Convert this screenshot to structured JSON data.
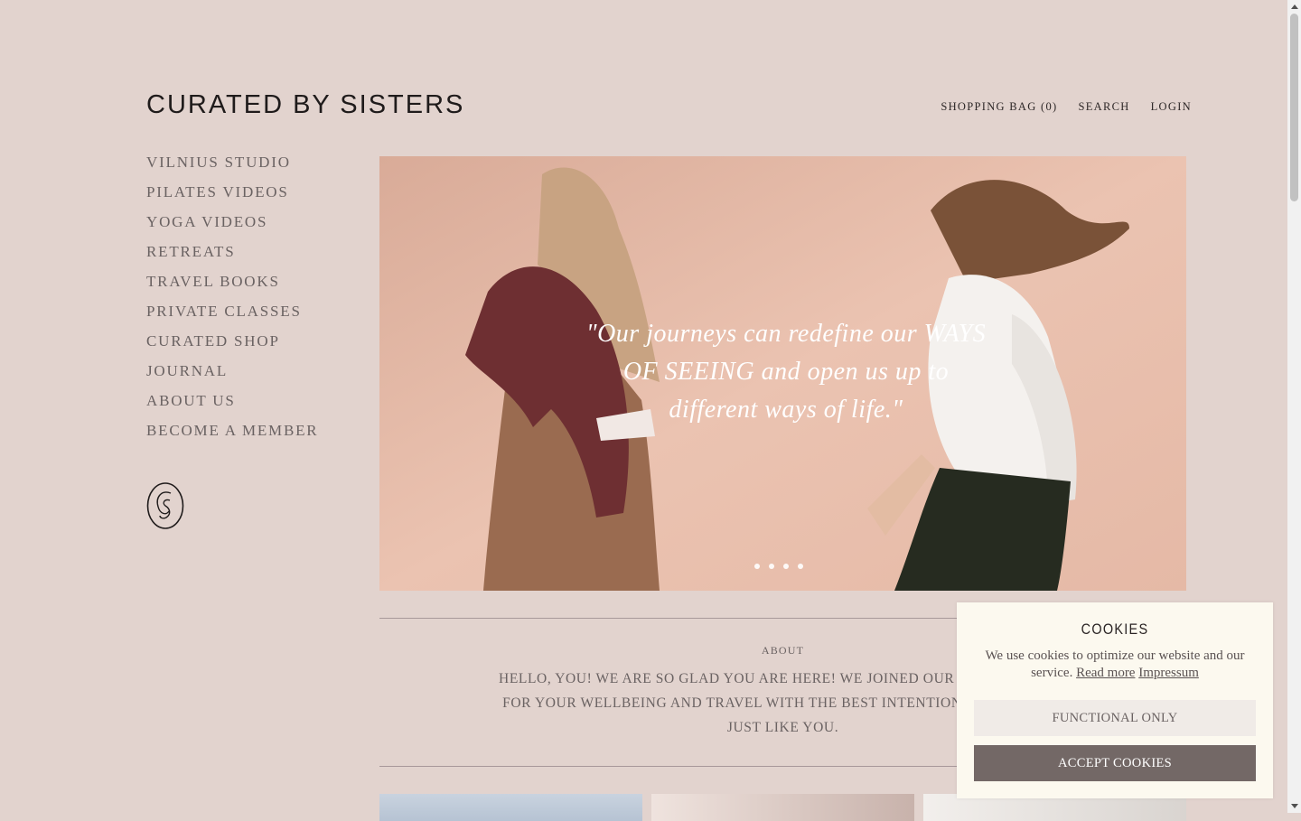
{
  "brand": {
    "logo": "CURATED BY SISTERS"
  },
  "topnav": {
    "bag": "SHOPPING BAG (0)",
    "search": "SEARCH",
    "login": "LOGIN"
  },
  "sidebar": {
    "items": [
      "VILNIUS STUDIO",
      "PILATES VIDEOS",
      "YOGA VIDEOS",
      "RETREATS",
      "TRAVEL BOOKS",
      "PRIVATE CLASSES",
      "CURATED SHOP",
      "JOURNAL",
      "ABOUT US",
      "BECOME A MEMBER"
    ],
    "monogram_icon": "cs-monogram-icon"
  },
  "hero": {
    "quote_line1": "\"Our journeys can redefine our WAYS",
    "quote_line2": "OF SEEING and open us up to",
    "quote_line3": "different ways of life.\"",
    "slide_count": 4,
    "active_slide": 1
  },
  "about": {
    "label": "ABOUT",
    "line1": "HELLO, YOU! WE ARE SO GLAD YOU ARE HERE! WE JOINED OUR SISTER ENERGI",
    "line2": "FOR YOUR WELLBEING AND TRAVEL WITH THE BEST INTENTION OF GATHERIN",
    "line3": "JUST LIKE YOU."
  },
  "cookie": {
    "title": "COOKIES",
    "text": "We use cookies to optimize our website and our service.",
    "read_more": "Read more",
    "impressum": "Impressum",
    "functional_label": "FUNCTIONAL ONLY",
    "accept_label": "ACCEPT COOKIES"
  },
  "colors": {
    "background": "#e2d3ce",
    "cookie_bg": "#fcf9ef",
    "accept_button": "#736866"
  }
}
